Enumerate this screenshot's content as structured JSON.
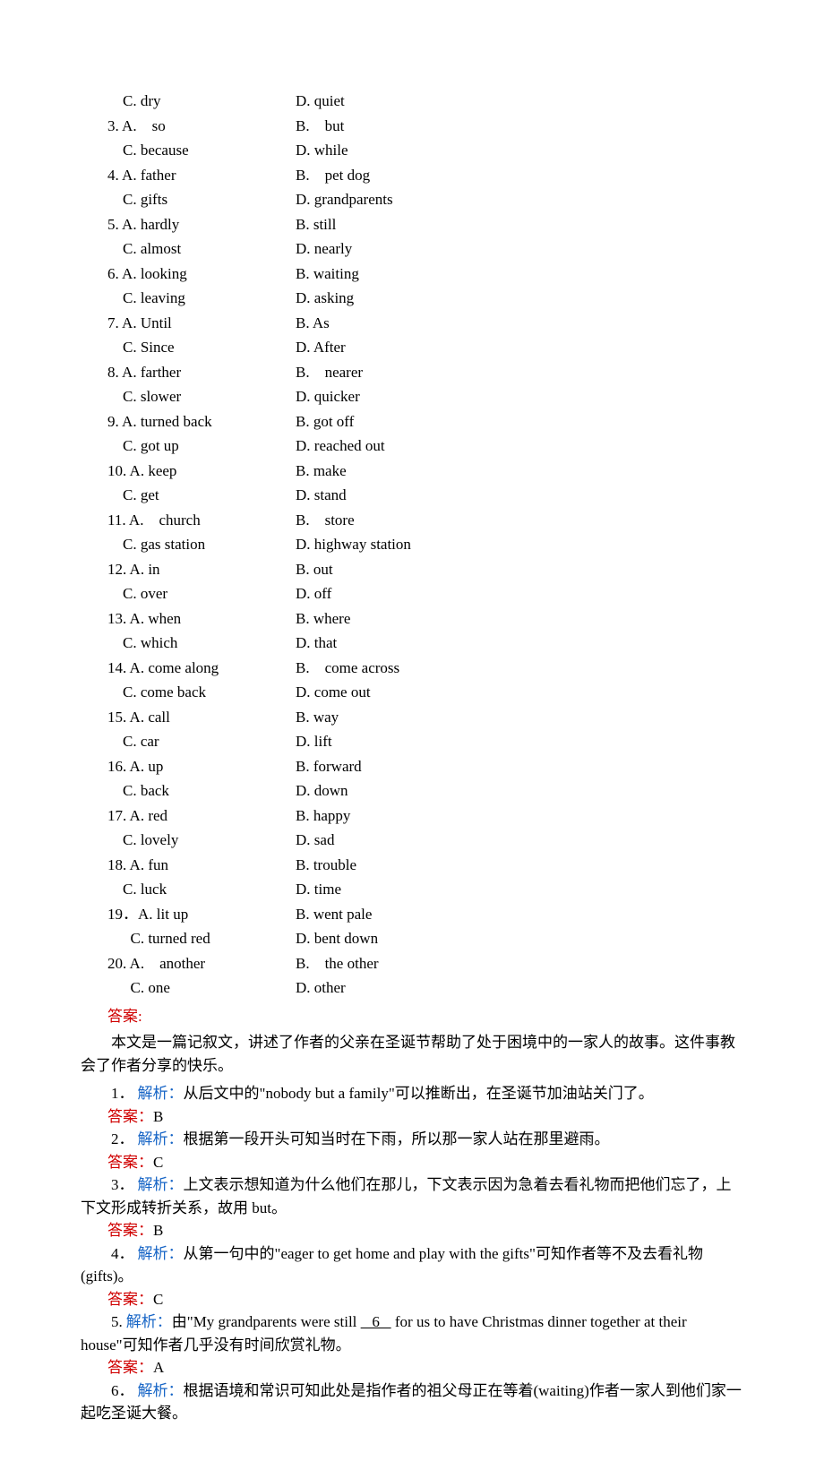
{
  "mc": [
    {
      "rows": [
        [
          {
            "text": "    C. dry"
          },
          {
            "text": "D. quiet"
          }
        ]
      ]
    },
    {
      "rows": [
        [
          {
            "text": "3. A.    so"
          },
          {
            "text": "B.    but"
          }
        ],
        [
          {
            "text": "    C. because"
          },
          {
            "text": "D. while"
          }
        ]
      ]
    },
    {
      "rows": [
        [
          {
            "text": "4. A. father"
          },
          {
            "text": "B.    pet dog"
          }
        ],
        [
          {
            "text": "    C. gifts"
          },
          {
            "text": "D. grandparents"
          }
        ]
      ]
    },
    {
      "rows": [
        [
          {
            "text": "5. A. hardly"
          },
          {
            "text": "B. still"
          }
        ],
        [
          {
            "text": "    C. almost"
          },
          {
            "text": "D. nearly"
          }
        ]
      ]
    },
    {
      "rows": [
        [
          {
            "text": "6. A. looking"
          },
          {
            "text": "B. waiting"
          }
        ],
        [
          {
            "text": "    C. leaving"
          },
          {
            "text": "D. asking"
          }
        ]
      ]
    },
    {
      "rows": [
        [
          {
            "text": "7. A. Until"
          },
          {
            "text": "B. As"
          }
        ],
        [
          {
            "text": "    C. Since"
          },
          {
            "text": "D. After"
          }
        ]
      ]
    },
    {
      "rows": [
        [
          {
            "text": "8. A. farther"
          },
          {
            "text": "B.    nearer"
          }
        ],
        [
          {
            "text": "    C. slower"
          },
          {
            "text": "D. quicker"
          }
        ]
      ]
    },
    {
      "rows": [
        [
          {
            "text": "9. A. turned back"
          },
          {
            "text": "B. got off"
          }
        ],
        [
          {
            "text": "    C. got up"
          },
          {
            "text": "D. reached out"
          }
        ]
      ]
    },
    {
      "rows": [
        [
          {
            "text": "10. A. keep"
          },
          {
            "text": "B. make"
          }
        ],
        [
          {
            "text": "    C. get"
          },
          {
            "text": "D. stand"
          }
        ]
      ]
    },
    {
      "rows": [
        [
          {
            "text": "11. A.    church"
          },
          {
            "text": "B.    store"
          }
        ],
        [
          {
            "text": "    C. gas station"
          },
          {
            "text": "D. highway station"
          }
        ]
      ]
    },
    {
      "rows": [
        [
          {
            "text": "12. A. in"
          },
          {
            "text": "B. out"
          }
        ],
        [
          {
            "text": "    C. over"
          },
          {
            "text": "D. off"
          }
        ]
      ]
    },
    {
      "rows": [
        [
          {
            "text": "13. A. when"
          },
          {
            "text": "B. where"
          }
        ],
        [
          {
            "text": "    C. which"
          },
          {
            "text": "D. that"
          }
        ]
      ]
    },
    {
      "rows": [
        [
          {
            "text": "14. A. come along"
          },
          {
            "text": "B.    come across"
          }
        ],
        [
          {
            "text": "    C. come back"
          },
          {
            "text": "D. come out"
          }
        ]
      ]
    },
    {
      "rows": [
        [
          {
            "text": "15. A. call"
          },
          {
            "text": "B. way"
          }
        ],
        [
          {
            "text": "    C. car"
          },
          {
            "text": "D. lift"
          }
        ]
      ]
    },
    {
      "rows": [
        [
          {
            "text": "16. A. up"
          },
          {
            "text": "B. forward"
          }
        ],
        [
          {
            "text": "    C. back"
          },
          {
            "text": "D. down"
          }
        ]
      ]
    },
    {
      "rows": [
        [
          {
            "text": "17. A. red"
          },
          {
            "text": "B. happy"
          }
        ],
        [
          {
            "text": "    C. lovely"
          },
          {
            "text": "D. sad"
          }
        ]
      ]
    },
    {
      "rows": [
        [
          {
            "text": "18. A. fun"
          },
          {
            "text": "B. trouble"
          }
        ],
        [
          {
            "text": "    C. luck"
          },
          {
            "text": "D. time"
          }
        ]
      ]
    },
    {
      "rows": [
        [
          {
            "text": "19．A. lit up"
          },
          {
            "text": "B. went pale"
          }
        ],
        [
          {
            "text": "      C. turned red"
          },
          {
            "text": "D. bent down"
          }
        ]
      ]
    },
    {
      "rows": [
        [
          {
            "text": "20. A.    another    "
          },
          {
            "text": "B.    the other"
          }
        ],
        [
          {
            "text": "      C. one"
          },
          {
            "text": "D. other"
          }
        ]
      ]
    }
  ],
  "answers_label": "答案:",
  "intro": "本文是一篇记叙文，讲述了作者的父亲在圣诞节帮助了处于困境中的一家人的故事。这件事教会了作者分享的快乐。",
  "explanations": [
    {
      "num": "1．",
      "label": "解析：",
      "body_before": "从后文中的\"nobody but a family\"可以推断出，在圣诞节加油站关门了。",
      "ans_label": "答案：",
      "ans": "B"
    },
    {
      "num": "2．",
      "label": "解析：",
      "body_before": "根据第一段开头可知当时在下雨，所以那一家人站在那里避雨。",
      "ans_label": "答案：",
      "ans": "C"
    },
    {
      "num": "3．",
      "label": "解析：",
      "body_before": "上文表示想知道为什么他们在那儿，下文表示因为急着去看礼物而把他们忘了，上下文形成转折关系，故用 but。",
      "ans_label": "答案：",
      "ans": "B"
    },
    {
      "num": "4．",
      "label": "解析：",
      "body_before": "从第一句中的\"eager to get home and play with the gifts\"可知作者等不及去看礼物(gifts)。",
      "ans_label": "答案：",
      "ans": "C"
    },
    {
      "num": "5.",
      "label": "解析：",
      "body_before": "由\"My grandparents were still ",
      "blank": "   6   ",
      "body_after": " for us to have Christmas dinner together at their house\"可知作者几乎没有时间欣赏礼物。",
      "ans_label": "答案：",
      "ans": "A"
    },
    {
      "num": "6．",
      "label": "解析：",
      "body_before": "根据语境和常识可知此处是指作者的祖父母正在等着(waiting)作者一家人到他们家一起吃圣诞大餐。",
      "ans_label": "",
      "ans": ""
    }
  ]
}
